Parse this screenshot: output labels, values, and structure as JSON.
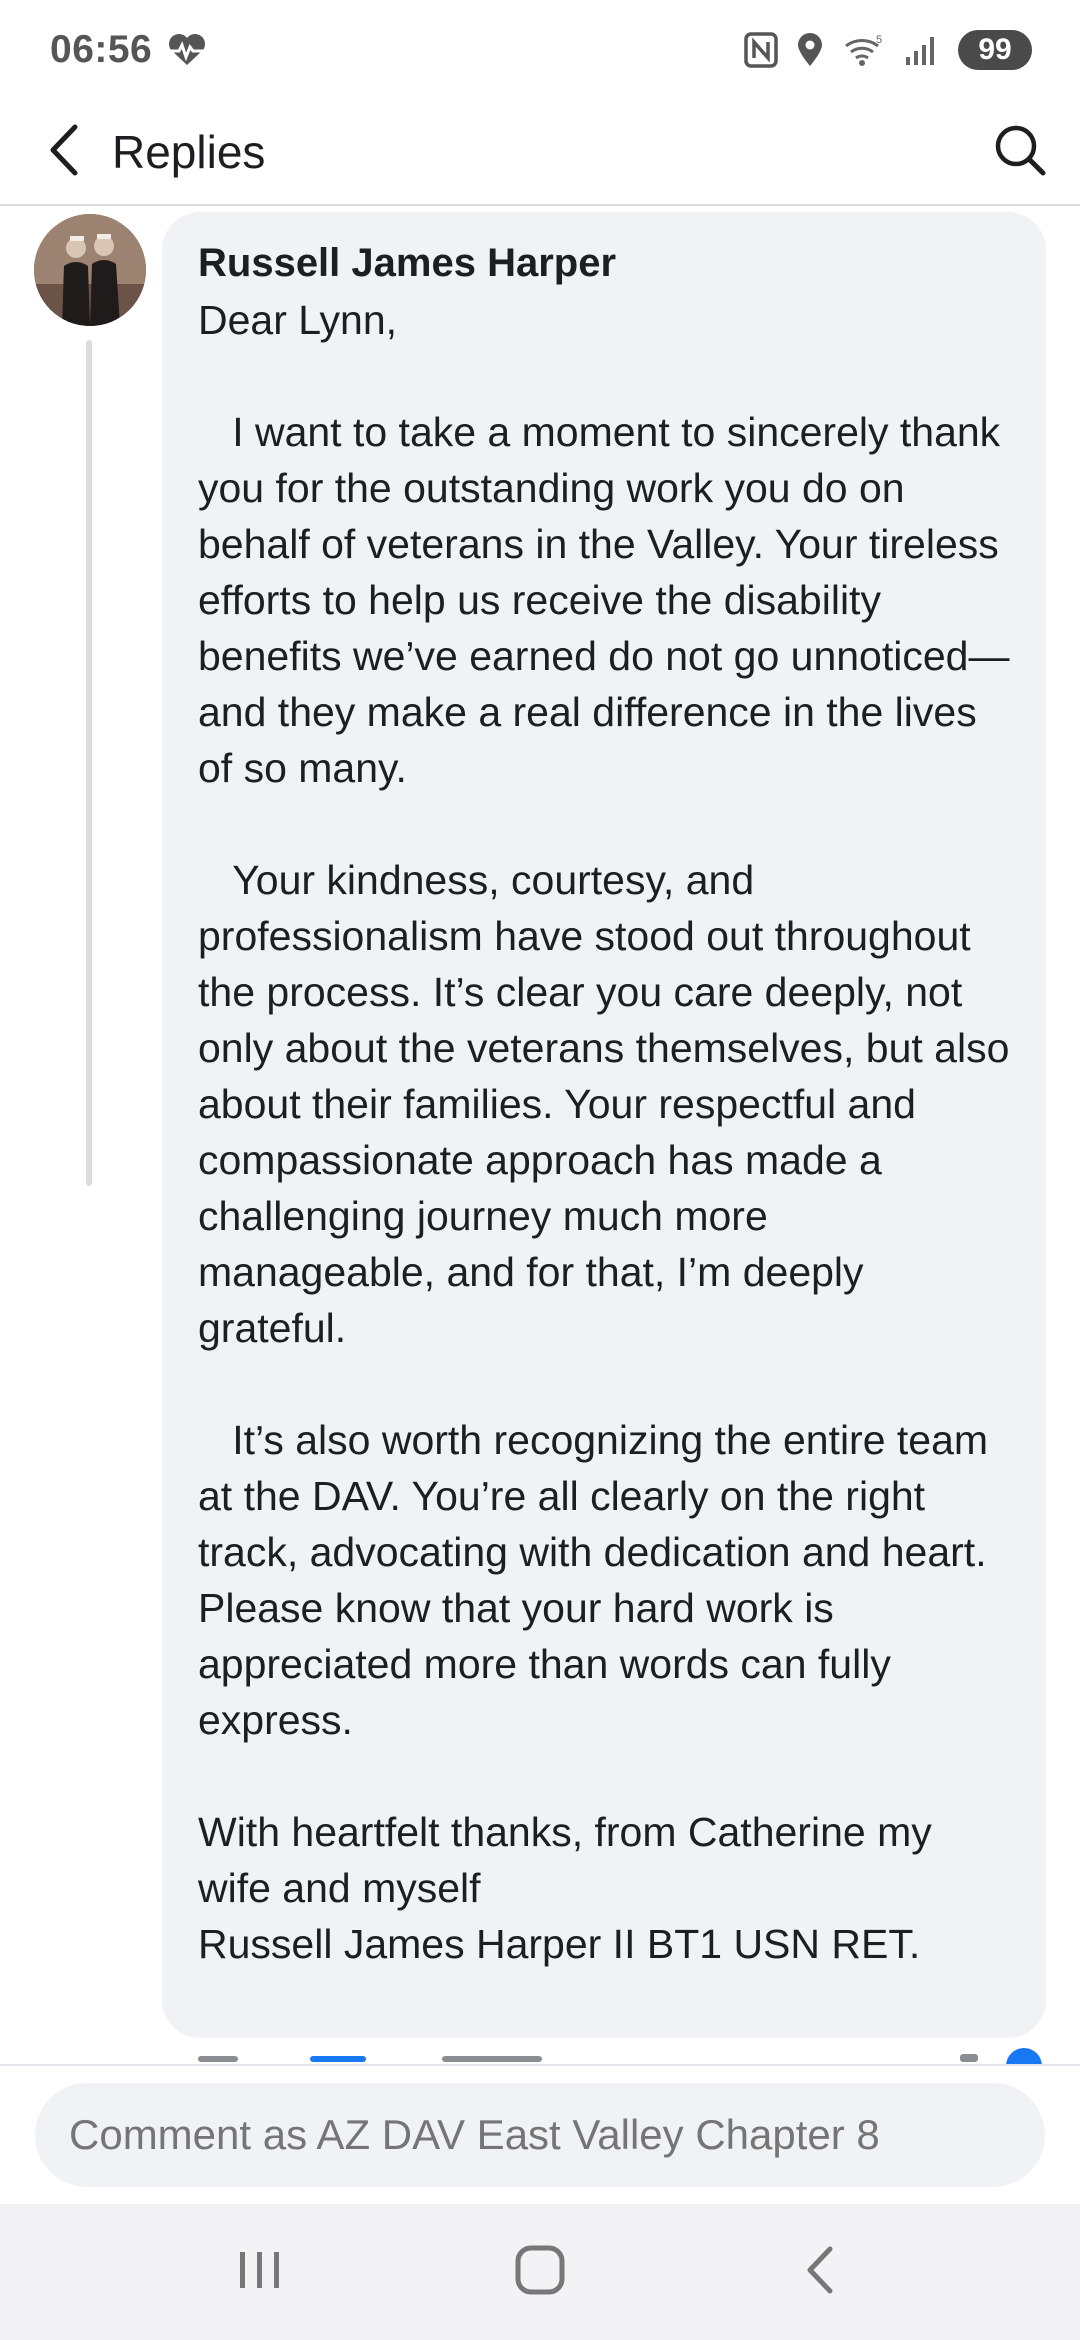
{
  "status_bar": {
    "time": "06:56",
    "battery_level": "99",
    "network_label": "5"
  },
  "header": {
    "title": "Replies"
  },
  "comment": {
    "author": "Russell James Harper",
    "text": "Dear Lynn,\n\n   I want to take a moment to sincerely thank you for the outstanding work you do on behalf of veterans in the Valley. Your tireless efforts to help us receive the disability benefits we’ve earned do not go unnoticed—and they make a real difference in the lives of so many.\n\n   Your kindness, courtesy, and professionalism have stood out throughout the process. It’s clear you care deeply, not only about the veterans themselves, but also about their families. Your respectful and compassionate approach has made a challenging journey much more manageable, and for that, I’m deeply grateful.\n\n   It’s also worth recognizing the entire team at the DAV. You’re all clearly on the right track, advocating with dedication and heart. Please know that your hard work is appreciated more than words can fully express.\n\nWith heartfelt thanks, from Catherine my wife and myself\nRussell James Harper II BT1 USN RET."
  },
  "comment_bar": {
    "placeholder": "Comment as AZ DAV East Valley Chapter 8"
  },
  "colors": {
    "bubble_bg": "#f0f2f5",
    "accent": "#1877f2",
    "text": "#1c1e21",
    "muted": "#65676b"
  },
  "icons": [
    "heart-pulse-icon",
    "nfc-icon",
    "location-icon",
    "wifi-icon",
    "signal-icon",
    "back-arrow-icon",
    "search-icon",
    "recent-apps-icon",
    "home-icon",
    "nav-back-icon"
  ]
}
